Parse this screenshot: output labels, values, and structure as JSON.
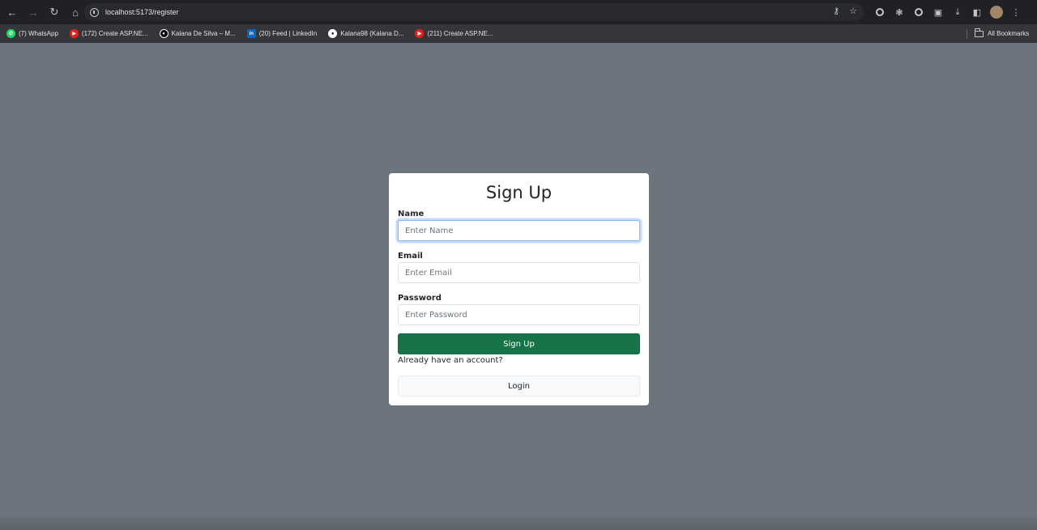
{
  "browser": {
    "url": "localhost:5173/register",
    "bookmarks": [
      {
        "label": "(7) WhatsApp",
        "icon": "whatsapp-icon"
      },
      {
        "label": "(172) Create ASP.NE...",
        "icon": "youtube-icon"
      },
      {
        "label": "Kalana De Silva – M...",
        "icon": "medium-icon"
      },
      {
        "label": "(20) Feed | LinkedIn",
        "icon": "linkedin-icon"
      },
      {
        "label": "Kalana98 (Kalana D...",
        "icon": "github-icon"
      },
      {
        "label": "(211) Create ASP.NE...",
        "icon": "youtube-icon"
      }
    ],
    "all_bookmarks": "All Bookmarks"
  },
  "form": {
    "title": "Sign Up",
    "name": {
      "label": "Name",
      "placeholder": "Enter Name",
      "value": ""
    },
    "email": {
      "label": "Email",
      "placeholder": "Enter Email",
      "value": ""
    },
    "password": {
      "label": "Password",
      "placeholder": "Enter Password",
      "value": ""
    },
    "submit_label": "Sign Up",
    "account_prompt": "Already have an account?",
    "login_label": "Login"
  },
  "colors": {
    "page_background": "#6c757d",
    "primary_button": "#157347",
    "focus_ring": "#86b7fe"
  }
}
